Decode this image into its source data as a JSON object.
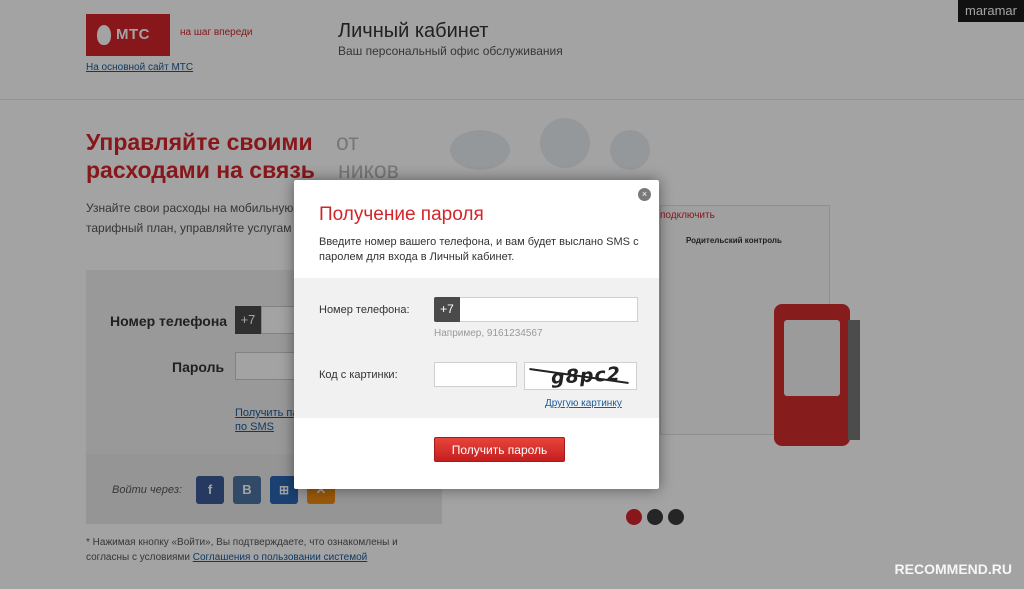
{
  "header": {
    "logo_text": "МТС",
    "slogan": "на шаг впереди",
    "main_site_link": "На основной сайт МТС",
    "title": "Личный кабинет",
    "subtitle": "Ваш персональный офис обслуживания",
    "watermark_user": "maramar"
  },
  "background": {
    "hero_line1": "Управляйте своими",
    "hero_line2": "расходами на связь",
    "hero_ghost_line1": "от",
    "hero_ghost_line2": "ников",
    "hero_desc_line1": "Узнайте свои расходы на мобильную",
    "hero_desc_line2": "тарифный план, управляйте услугам",
    "phone_label": "Номер телефона",
    "phone_prefix": "+7",
    "password_label": "Пароль",
    "get_password_line1": "Получить па",
    "get_password_line2": "по SMS",
    "social_label": "Войти через:",
    "social_fb": "f",
    "social_vk": "B",
    "social_win": "⊞",
    "social_ok": "✕",
    "disclaimer_text": "* Нажимая кнопку «Войти», Вы подтверждаете, что ознакомлены и согласны с условиями ",
    "disclaimer_link": "Соглашения о пользовании системой",
    "illus_title": "подключить",
    "illus_sub": "Родительский контроль",
    "recommend_watermark": "RECOMMEND.RU"
  },
  "modal": {
    "close_icon": "×",
    "title": "Получение пароля",
    "description": "Введите номер вашего телефона, и вам будет выслано SMS с паролем для входа в Личный кабинет.",
    "phone_label": "Номер телефона:",
    "phone_prefix": "+7",
    "phone_value": "",
    "phone_hint": "Например, 9161234567",
    "code_label": "Код с картинки:",
    "code_value": "",
    "captcha_text": "g8pc2",
    "other_image_link": "Другую картинку",
    "submit_label": "Получить пароль"
  },
  "colors": {
    "brand_red": "#d3242a",
    "link_blue": "#1a5b9a"
  }
}
